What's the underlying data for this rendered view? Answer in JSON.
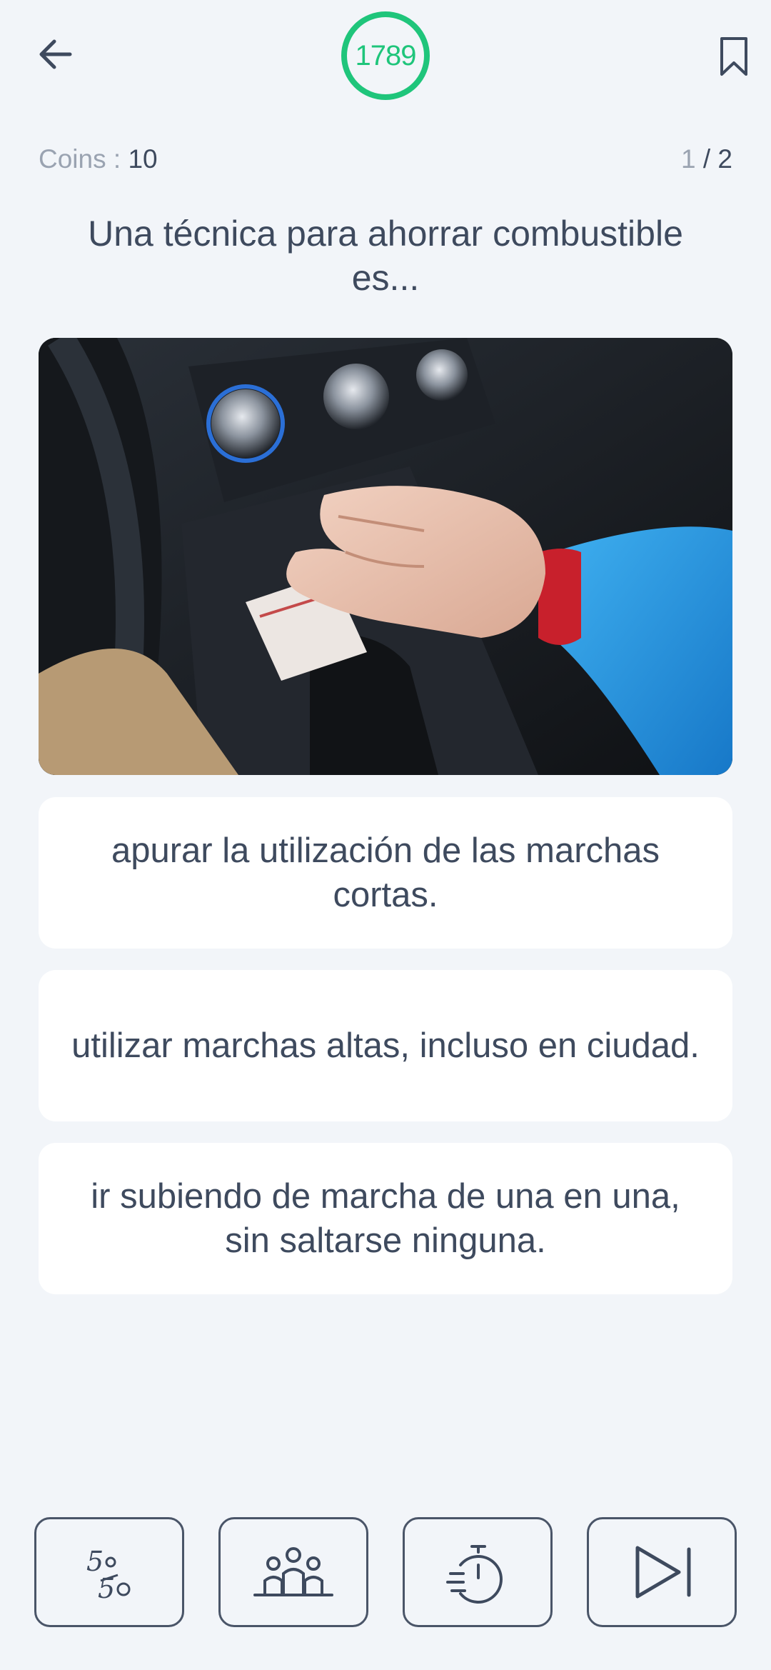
{
  "header": {
    "back_icon": "arrow-left-icon",
    "timer_value": "1789",
    "timer_color": "#1fc57b",
    "bookmark_icon": "bookmark-icon"
  },
  "stats": {
    "coins_label": "Coins : ",
    "coins_value": "10",
    "progress_current": "1",
    "progress_separator": " / ",
    "progress_total": "2"
  },
  "question": {
    "text": "Una técnica para ahorrar combustible es..."
  },
  "answers": [
    {
      "text": "apurar la utilización de las marchas cortas."
    },
    {
      "text": "utilizar marchas altas, incluso en ciudad."
    },
    {
      "text": "ir subiendo de marcha de una en una, sin saltarse ninguna."
    }
  ],
  "lifelines": [
    {
      "icon": "fifty-fifty-icon"
    },
    {
      "icon": "audience-icon"
    },
    {
      "icon": "time-freeze-icon"
    },
    {
      "icon": "skip-icon"
    }
  ],
  "colors": {
    "background": "#f2f5f9",
    "card": "#ffffff",
    "text": "#3e4a5e",
    "muted": "#9aa3b1",
    "accent": "#1fc57b"
  }
}
